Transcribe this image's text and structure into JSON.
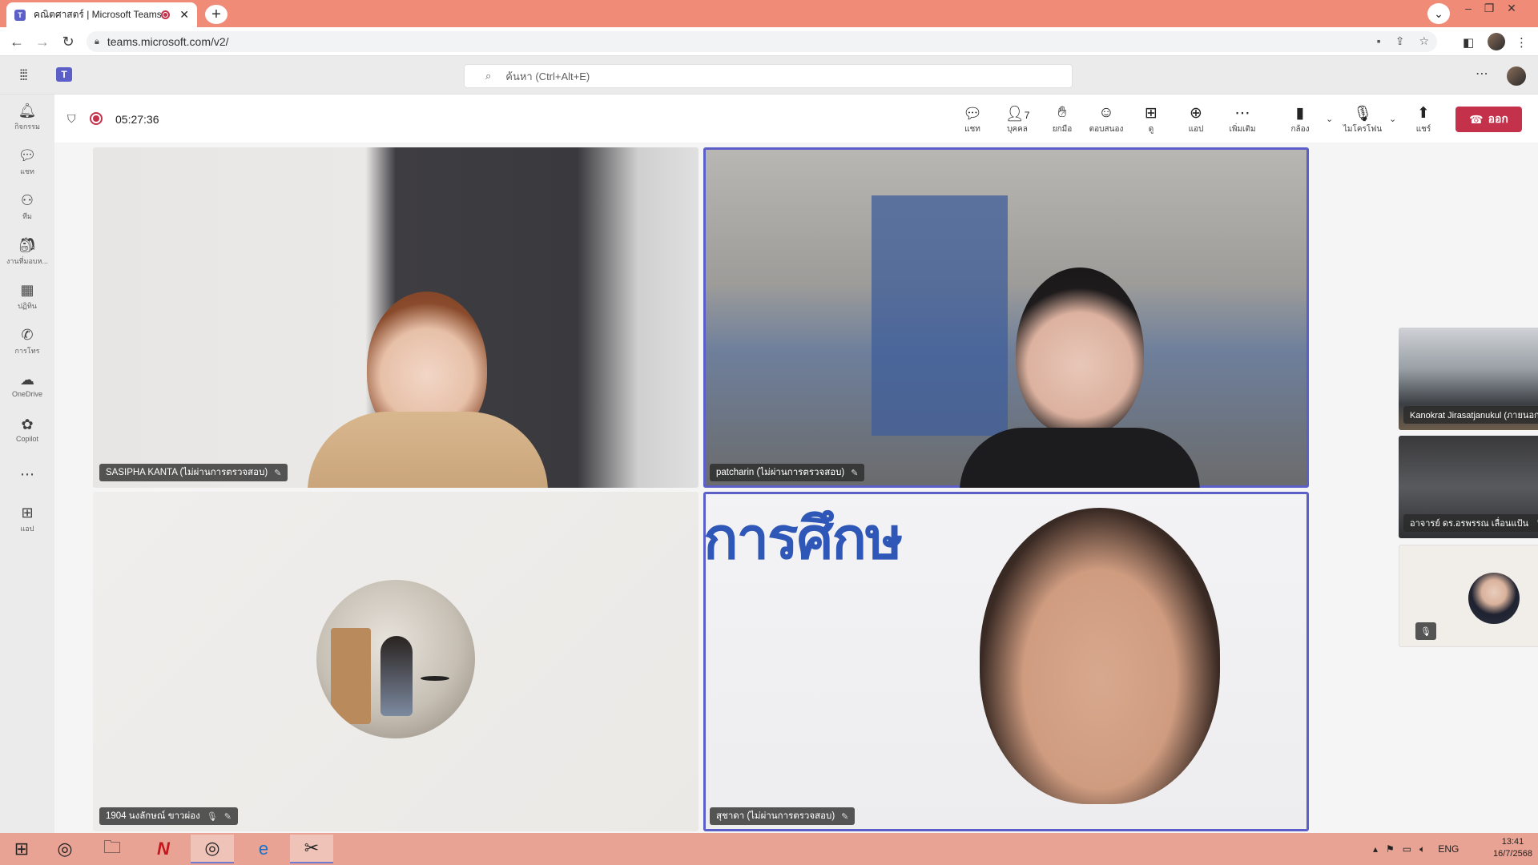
{
  "browser": {
    "tab_title": "คณิตศาสตร์ | Microsoft Teams",
    "tab_close": "✕",
    "new_tab": "+",
    "url": "teams.microsoft.com/v2/"
  },
  "teams": {
    "search_placeholder": "ค้นหา (Ctrl+Alt+E)",
    "rail": [
      {
        "label": "กิจกรรม",
        "icon": "bell-icon"
      },
      {
        "label": "แชท",
        "icon": "chat-icon"
      },
      {
        "label": "ทีม",
        "icon": "teams-icon"
      },
      {
        "label": "งานที่มอบห...",
        "icon": "assignments-icon"
      },
      {
        "label": "ปฏิทิน",
        "icon": "calendar-icon"
      },
      {
        "label": "การโทร",
        "icon": "phone-icon"
      },
      {
        "label": "OneDrive",
        "icon": "cloud-icon"
      },
      {
        "label": "Copilot",
        "icon": "copilot-icon"
      },
      {
        "label": "แอป",
        "icon": "apps-icon"
      }
    ]
  },
  "meeting": {
    "timer": "05:27:36",
    "toolbar": {
      "chat": "แชท",
      "people": "บุคคล",
      "people_count": "7",
      "raise": "ยกมือ",
      "react": "ตอบสนอง",
      "view": "ดู",
      "apps": "แอป",
      "more": "เพิ่มเติม",
      "camera": "กล้อง",
      "mic": "ไมโครโฟน",
      "share": "แชร์",
      "leave": "ออก"
    },
    "participants": [
      {
        "name": "SASIPHA KANTA (ไม่ผ่านการตรวจสอบ)"
      },
      {
        "name": "patcharin (ไม่ผ่านการตรวจสอบ)"
      },
      {
        "name": "1904 นงลักษณ์ ขาวผ่อง"
      },
      {
        "name": "สุชาดา (ไม่ผ่านการตรวจสอบ)"
      }
    ],
    "banner_text": "การศึกษ",
    "thumbnails": [
      {
        "name": "Kanokrat Jirasatjanukul (ภายนอก)"
      },
      {
        "name": "อาจารย์ ดร.อรพรรณ เลื่อนแป้น"
      }
    ]
  },
  "taskbar": {
    "lang": "ENG",
    "time": "13:41",
    "date": "16/7/2568"
  }
}
